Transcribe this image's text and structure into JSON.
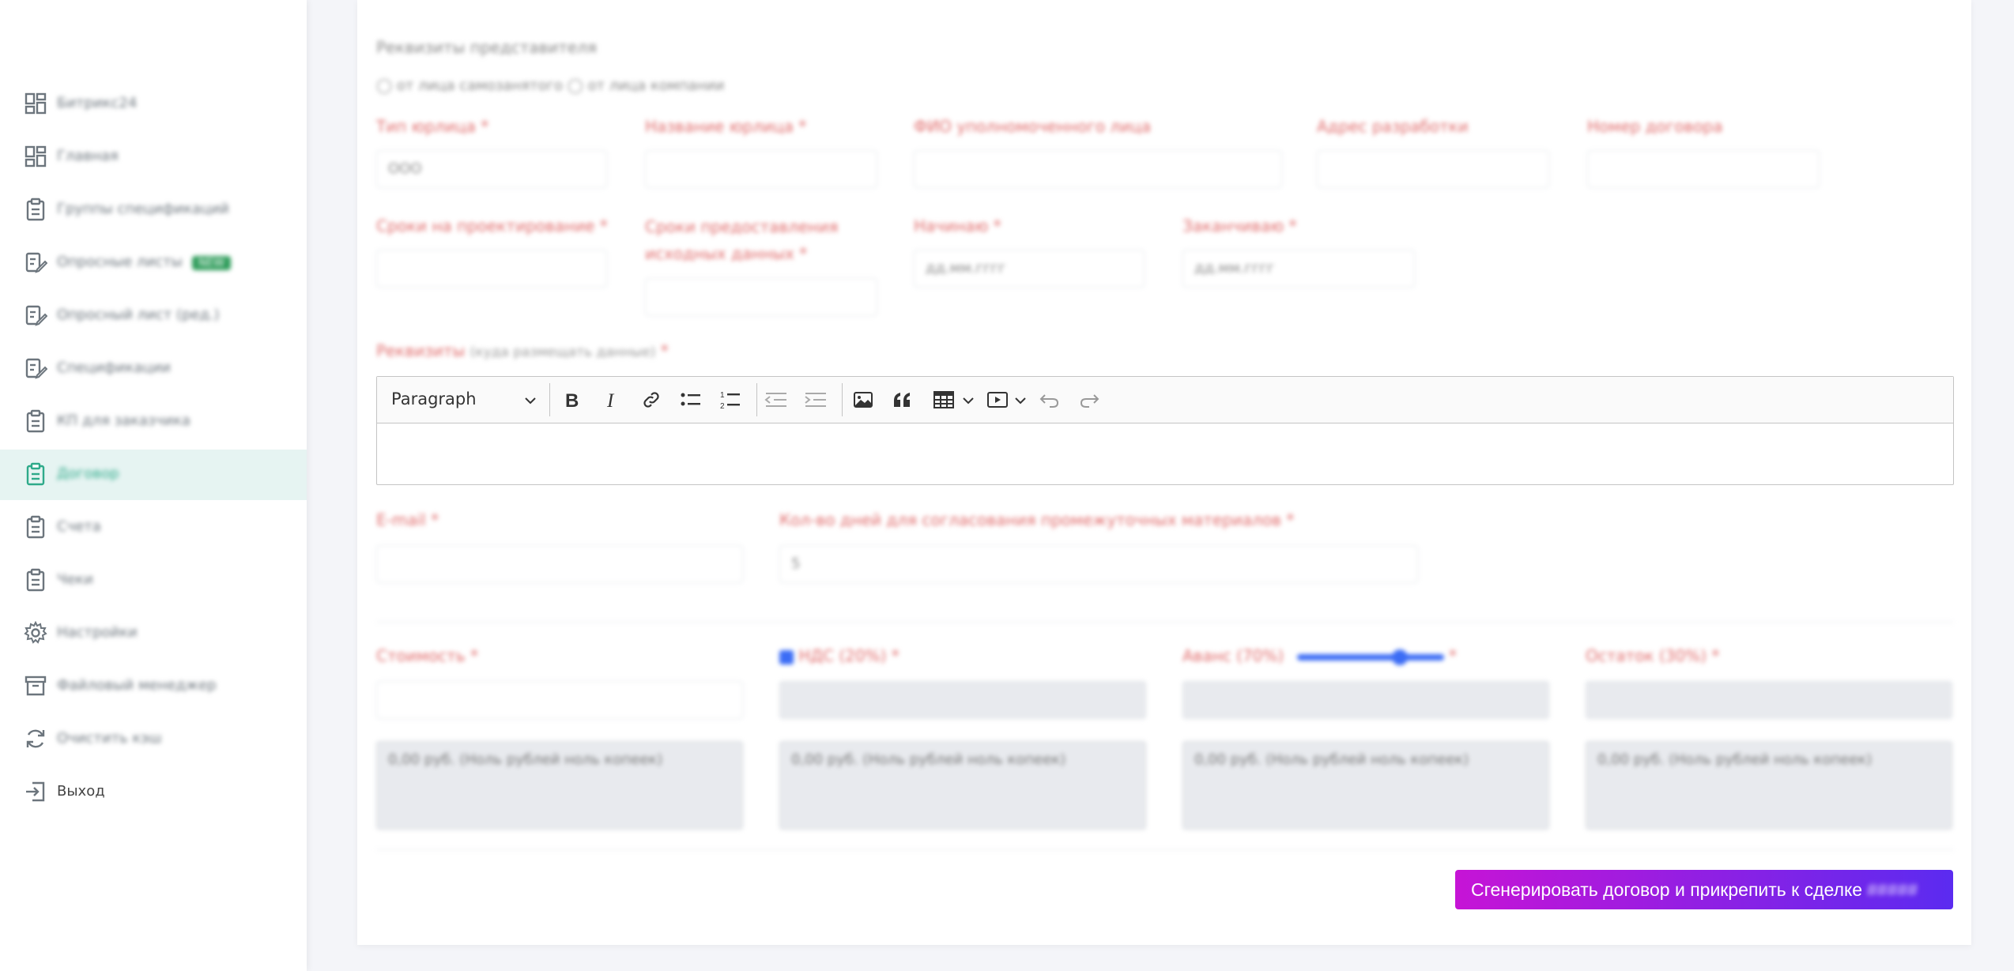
{
  "sidebar": {
    "items": [
      {
        "label": "Битрикс24",
        "icon": "dashboard-icon"
      },
      {
        "label": "Главная",
        "icon": "dashboard-icon"
      },
      {
        "label": "Группы спецификаций",
        "icon": "clipboard-icon"
      },
      {
        "label": "Опросные листы",
        "icon": "edit-list-icon",
        "badge": "NEW"
      },
      {
        "label": "Опросный лист (ред.)",
        "icon": "edit-list-icon"
      },
      {
        "label": "Спецификации",
        "icon": "edit-list-icon"
      },
      {
        "label": "КП для заказчика",
        "icon": "clipboard-icon"
      },
      {
        "label": "Договор",
        "icon": "clipboard-icon"
      },
      {
        "label": "Счета",
        "icon": "clipboard-icon"
      },
      {
        "label": "Чеки",
        "icon": "clipboard-icon"
      },
      {
        "label": "Настройки",
        "icon": "gear-icon"
      },
      {
        "label": "Файловый менеджер",
        "icon": "archive-icon"
      },
      {
        "label": "Очистить кэш",
        "icon": "refresh-icon"
      },
      {
        "label": "Выход",
        "icon": "logout-icon"
      }
    ],
    "active_index": 7
  },
  "form": {
    "section_title": "Реквизиты представителя",
    "radio_text": "◯ от лица самозанятого ◯ от лица компании",
    "fields_row1": {
      "type_label": "Тип юрлица *",
      "type_value": "ООО",
      "name_label": "Название юрлица *",
      "fio_label": "ФИО уполномоченного лица",
      "address_label": "Адрес разработки",
      "contract_num_label": "Номер договора"
    },
    "fields_row2": {
      "design_term_label": "Сроки на проектирование *",
      "data_term_label": "Сроки предоставления исходных данных *",
      "start_label": "Начинаю *",
      "start_placeholder": "дд.мм.гггг",
      "end_label": "Заканчиваю *",
      "end_placeholder": "дд.мм.гггг"
    },
    "requisites_label": "Реквизиты",
    "requisites_hint": "(куда размещать данные)",
    "editor": {
      "paragraph": "Paragraph"
    },
    "email_label": "E-mail *",
    "days_label": "Кол-во дней для согласования промежуточных материалов *",
    "days_value": "5",
    "cost_label": "Стоимость *",
    "vat_label": "НДС (20%) *",
    "advance_label": "Аванс (70%)",
    "remainder_label": "Остаток (30%) *",
    "amount_text": "0,00 руб. (Ноль рублей ноль копеек)",
    "generate_button": "Сгенерировать договор и прикрепить к сделке",
    "deal_id": "#####"
  },
  "colors": {
    "accent": "#2eaa8a",
    "required": "#e06b6b",
    "button_start": "#c614d6",
    "button_end": "#5b2bf0"
  }
}
